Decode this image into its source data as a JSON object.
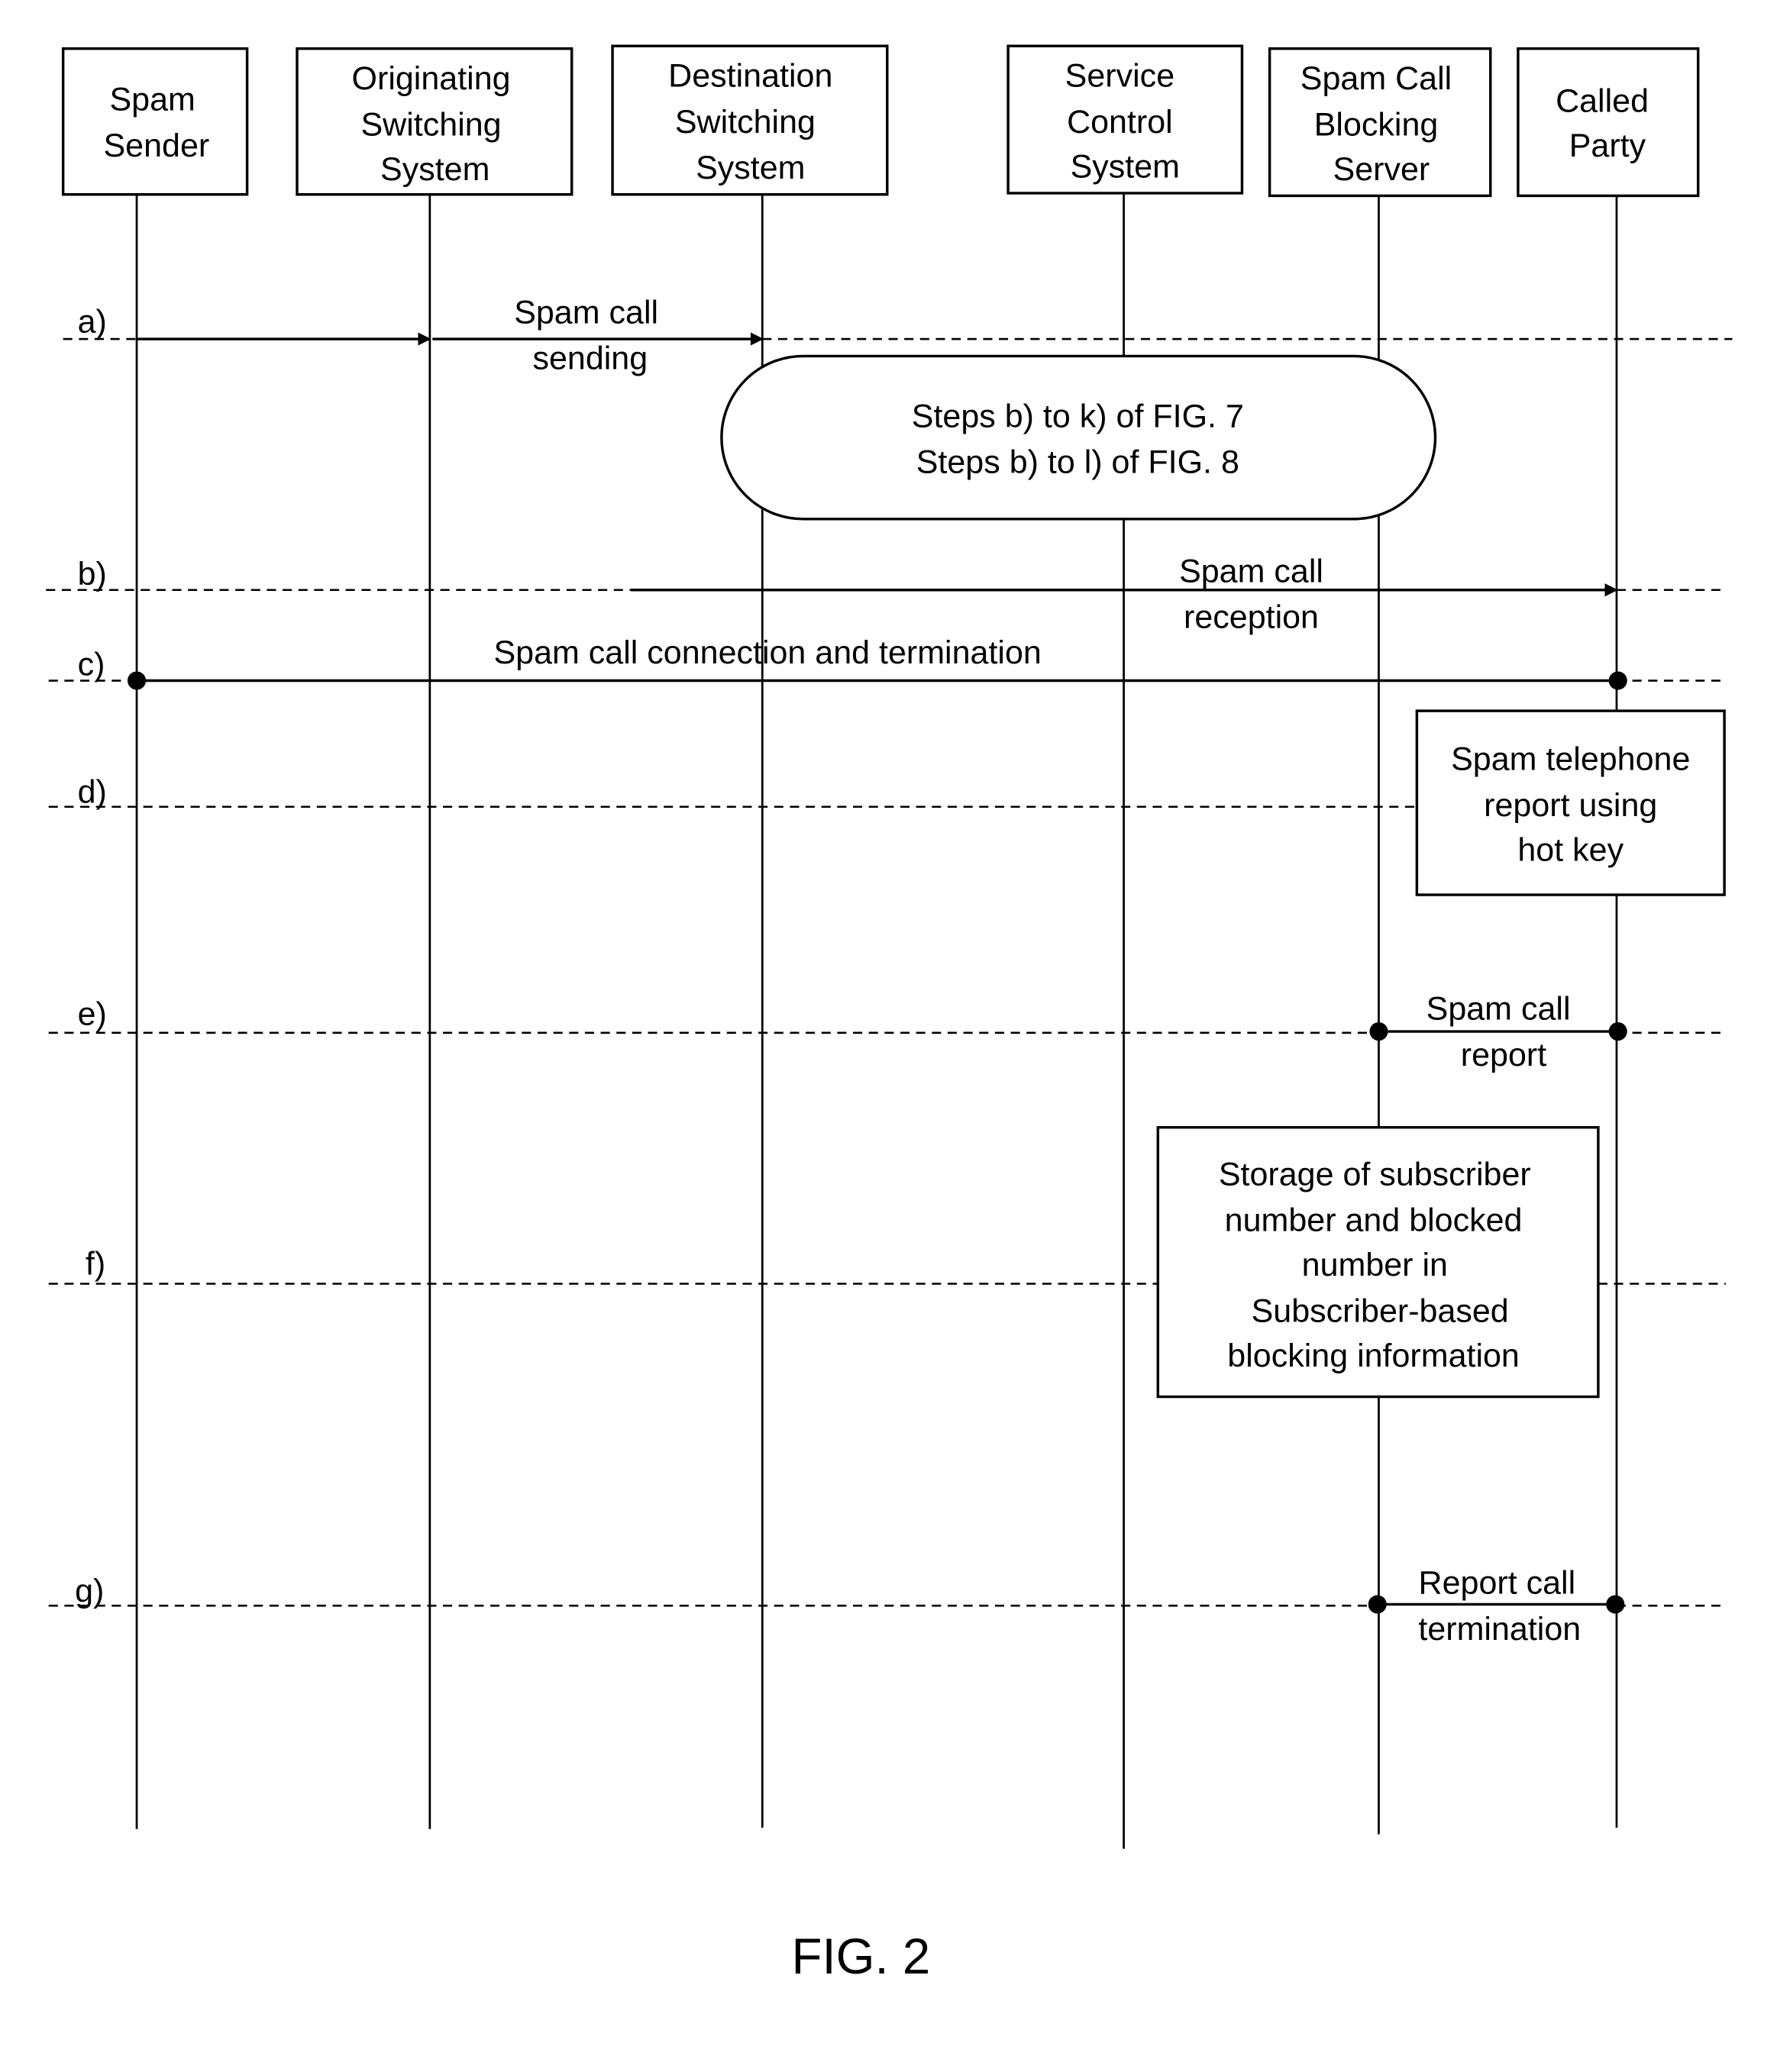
{
  "figure": {
    "caption": "FIG. 2",
    "type": "sequence-diagram"
  },
  "participants": [
    {
      "id": "spam-sender",
      "lines": [
        "Spam",
        "Sender"
      ]
    },
    {
      "id": "originating-switching-system",
      "lines": [
        "Originating",
        "Switching",
        "System"
      ]
    },
    {
      "id": "destination-switching-system",
      "lines": [
        "Destination",
        "Switching",
        "System"
      ]
    },
    {
      "id": "service-control-system",
      "lines": [
        "Service",
        "Control",
        "System"
      ]
    },
    {
      "id": "spam-call-blocking-server",
      "lines": [
        "Spam Call",
        "Blocking",
        "Server"
      ]
    },
    {
      "id": "called-party",
      "lines": [
        "Called",
        "Party"
      ]
    }
  ],
  "steps": [
    {
      "label": "a)",
      "message": [
        "Spam call",
        "sending"
      ],
      "from": "spam-sender",
      "to": "destination-switching-system",
      "style": "arrow"
    },
    {
      "label": "b)",
      "message": [
        "Spam call",
        "reception"
      ],
      "from": "destination-switching-system",
      "to": "called-party",
      "style": "arrow"
    },
    {
      "label": "c)",
      "message": [
        "Spam call connection and termination"
      ],
      "from": "spam-sender",
      "to": "called-party",
      "style": "dot"
    },
    {
      "label": "d)",
      "message": [],
      "note": "spam-telephone-report",
      "style": "note"
    },
    {
      "label": "e)",
      "message": [
        "Spam call",
        "report"
      ],
      "from": "spam-call-blocking-server",
      "to": "called-party",
      "style": "dot"
    },
    {
      "label": "f)",
      "message": [],
      "note": "storage-note",
      "style": "note"
    },
    {
      "label": "g)",
      "message": [
        "Report call",
        "termination"
      ],
      "from": "spam-call-blocking-server",
      "to": "called-party",
      "style": "dot"
    }
  ],
  "reference_oval": {
    "lines": [
      "Steps b) to k) of FIG. 7",
      "Steps b) to l) of FIG. 8"
    ]
  },
  "notes": {
    "spam-telephone-report": [
      "Spam telephone",
      "report using",
      "hot key"
    ],
    "storage-note": [
      "Storage of subscriber",
      "number and blocked",
      "number in",
      "Subscriber-based",
      "blocking information"
    ]
  }
}
